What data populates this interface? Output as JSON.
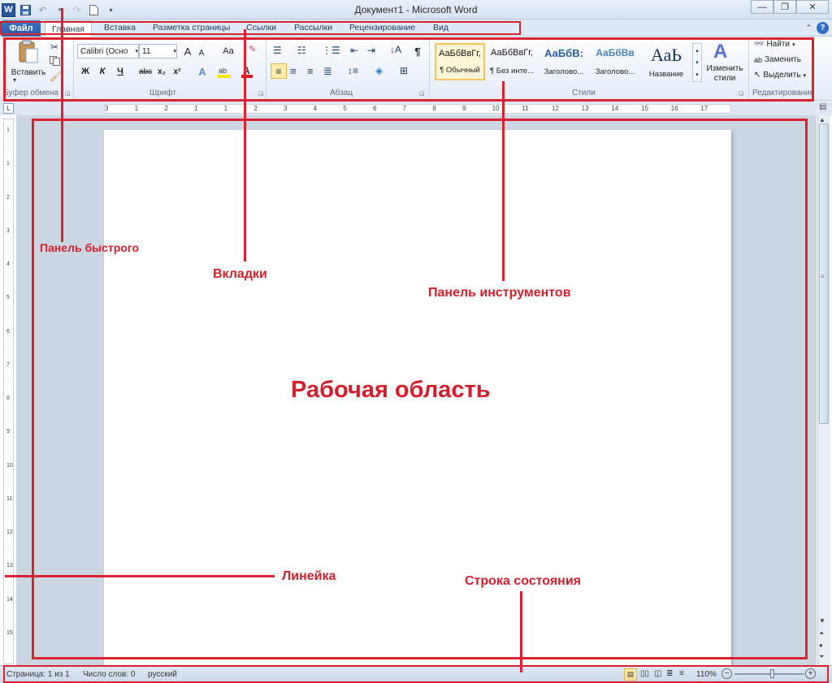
{
  "window": {
    "title": "Документ1 - Microsoft Word"
  },
  "colors": {
    "accent_red": "#d9242f",
    "file_tab": "#2a5aa6",
    "ribbon_bg": "#e4ecf7"
  },
  "tabs": {
    "file": "Файл",
    "items": [
      "Главная",
      "Вставка",
      "Разметка страницы",
      "Ссылки",
      "Рассылки",
      "Рецензирование",
      "Вид"
    ]
  },
  "ribbon": {
    "clipboard": {
      "paste": "Вставить",
      "label": "Буфер обмена"
    },
    "font": {
      "font_name": "Calibri (Осно",
      "font_size": "11",
      "grow": "A",
      "shrink": "A",
      "case": "Aa",
      "bold": "Ж",
      "italic": "К",
      "underline": "Ч",
      "strike": "abc",
      "subscript": "x₂",
      "superscript": "x²",
      "label": "Шрифт"
    },
    "paragraph": {
      "pilcrow": "¶",
      "label": "Абзац"
    },
    "styles": {
      "items": [
        {
          "preview": "АаБбВвГг,",
          "name": "¶ Обычный"
        },
        {
          "preview": "АаБбВвГг,",
          "name": "¶ Без инте..."
        },
        {
          "preview": "АаБбВ:",
          "name": "Заголово..."
        },
        {
          "preview": "АаБбВв",
          "name": "Заголово..."
        },
        {
          "preview": "АаЬ",
          "name": "Название"
        }
      ],
      "change_styles": "Изменить стили",
      "label": "Стили"
    },
    "editing": {
      "find": "Найти",
      "replace": "Заменить",
      "select": "Выделить",
      "label": "Редактирование"
    }
  },
  "ruler": {
    "h_ticks": [
      "3",
      "1",
      "2",
      "1",
      "1",
      "2",
      "3",
      "4",
      "5",
      "6",
      "7",
      "8",
      "9",
      "10",
      "11",
      "12",
      "13",
      "14",
      "15",
      "16",
      "17"
    ],
    "v_ticks": [
      "1",
      "1",
      "2",
      "3",
      "4",
      "5",
      "6",
      "7",
      "8",
      "9",
      "10",
      "11",
      "12",
      "13",
      "14",
      "15"
    ]
  },
  "status": {
    "page": "Страница: 1 из 1",
    "words": "Число слов: 0",
    "language": "русский",
    "zoom": "110%",
    "zoom_level": 0.55
  },
  "callouts": {
    "qat": "Панель быстрого",
    "tabs": "Вкладки",
    "toolbar": "Панель инструментов",
    "workarea": "Рабочая область",
    "ruler": "Линейка",
    "statusbar": "Строка состояния"
  }
}
